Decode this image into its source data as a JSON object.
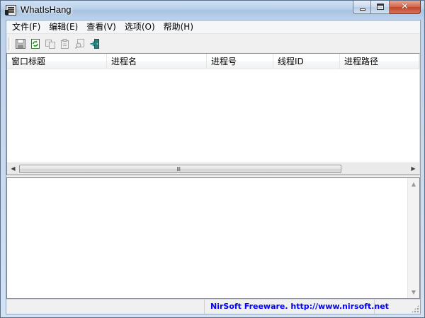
{
  "window": {
    "title": "WhatIsHang",
    "controls": {
      "minimize": "",
      "maximize": "",
      "close": "✕"
    }
  },
  "menu": {
    "items": [
      {
        "label": "文件(F)"
      },
      {
        "label": "编辑(E)"
      },
      {
        "label": "查看(V)"
      },
      {
        "label": "选项(O)"
      },
      {
        "label": "帮助(H)"
      }
    ]
  },
  "toolbar": {
    "buttons": [
      {
        "icon": "save-icon",
        "enabled": true
      },
      {
        "icon": "refresh-icon",
        "enabled": true
      },
      {
        "icon": "copy-icon",
        "enabled": false
      },
      {
        "icon": "properties-icon",
        "enabled": false
      },
      {
        "icon": "find-icon",
        "enabled": false
      },
      {
        "icon": "exit-icon",
        "enabled": true
      }
    ]
  },
  "list": {
    "columns": [
      {
        "label": "窗口标题"
      },
      {
        "label": "进程名"
      },
      {
        "label": "进程号"
      },
      {
        "label": "线程ID"
      },
      {
        "label": "进程路径"
      }
    ],
    "rows": [],
    "scroll_grip": "Ⅲ"
  },
  "lower_pane": {
    "text": ""
  },
  "status": {
    "left": "",
    "link": "NirSoft Freeware.  http://www.nirsoft.net"
  },
  "colors": {
    "link": "#0000ff",
    "accent": "#a9c3e1"
  }
}
